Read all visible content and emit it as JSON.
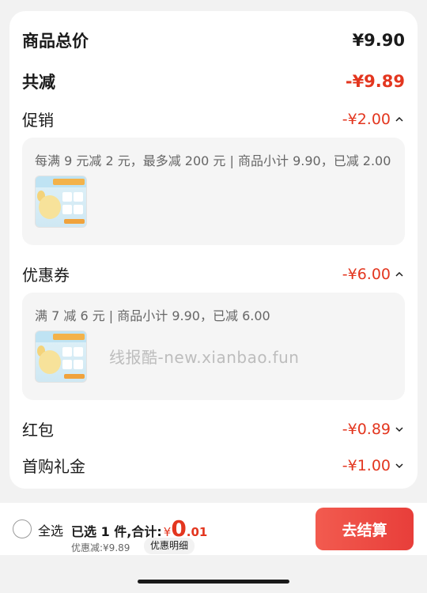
{
  "summary": {
    "total_label": "商品总价",
    "total_value": "¥9.90",
    "discount_label": "共减",
    "discount_value": "-¥9.89"
  },
  "promo": {
    "label": "促销",
    "value": "-¥2.00",
    "desc": "每满 9 元减 2 元，最多减 200 元 | 商品小计 9.90，已减 2.00"
  },
  "coupon": {
    "label": "优惠券",
    "value": "-¥6.00",
    "desc": "满 7 减 6 元 | 商品小计 9.90，已减 6.00"
  },
  "red_packet": {
    "label": "红包",
    "value": "-¥0.89"
  },
  "first_gift": {
    "label": "首购礼金",
    "value": "-¥1.00"
  },
  "watermark": "线报酷-new.xianbao.fun",
  "bottom_bar": {
    "select_all": "全选",
    "selected_text": "已选 1 件,合计:",
    "yen": "¥",
    "total_int": "0",
    "total_dec": ".01",
    "saved_text": "优惠减:¥9.89",
    "detail_label": "优惠明细",
    "checkout_label": "去结算"
  },
  "icons": {
    "expand": "chevron-up-icon",
    "collapse": "chevron-down-icon"
  },
  "colors": {
    "accent": "#e3361f",
    "checkout": "#e83e3a"
  }
}
